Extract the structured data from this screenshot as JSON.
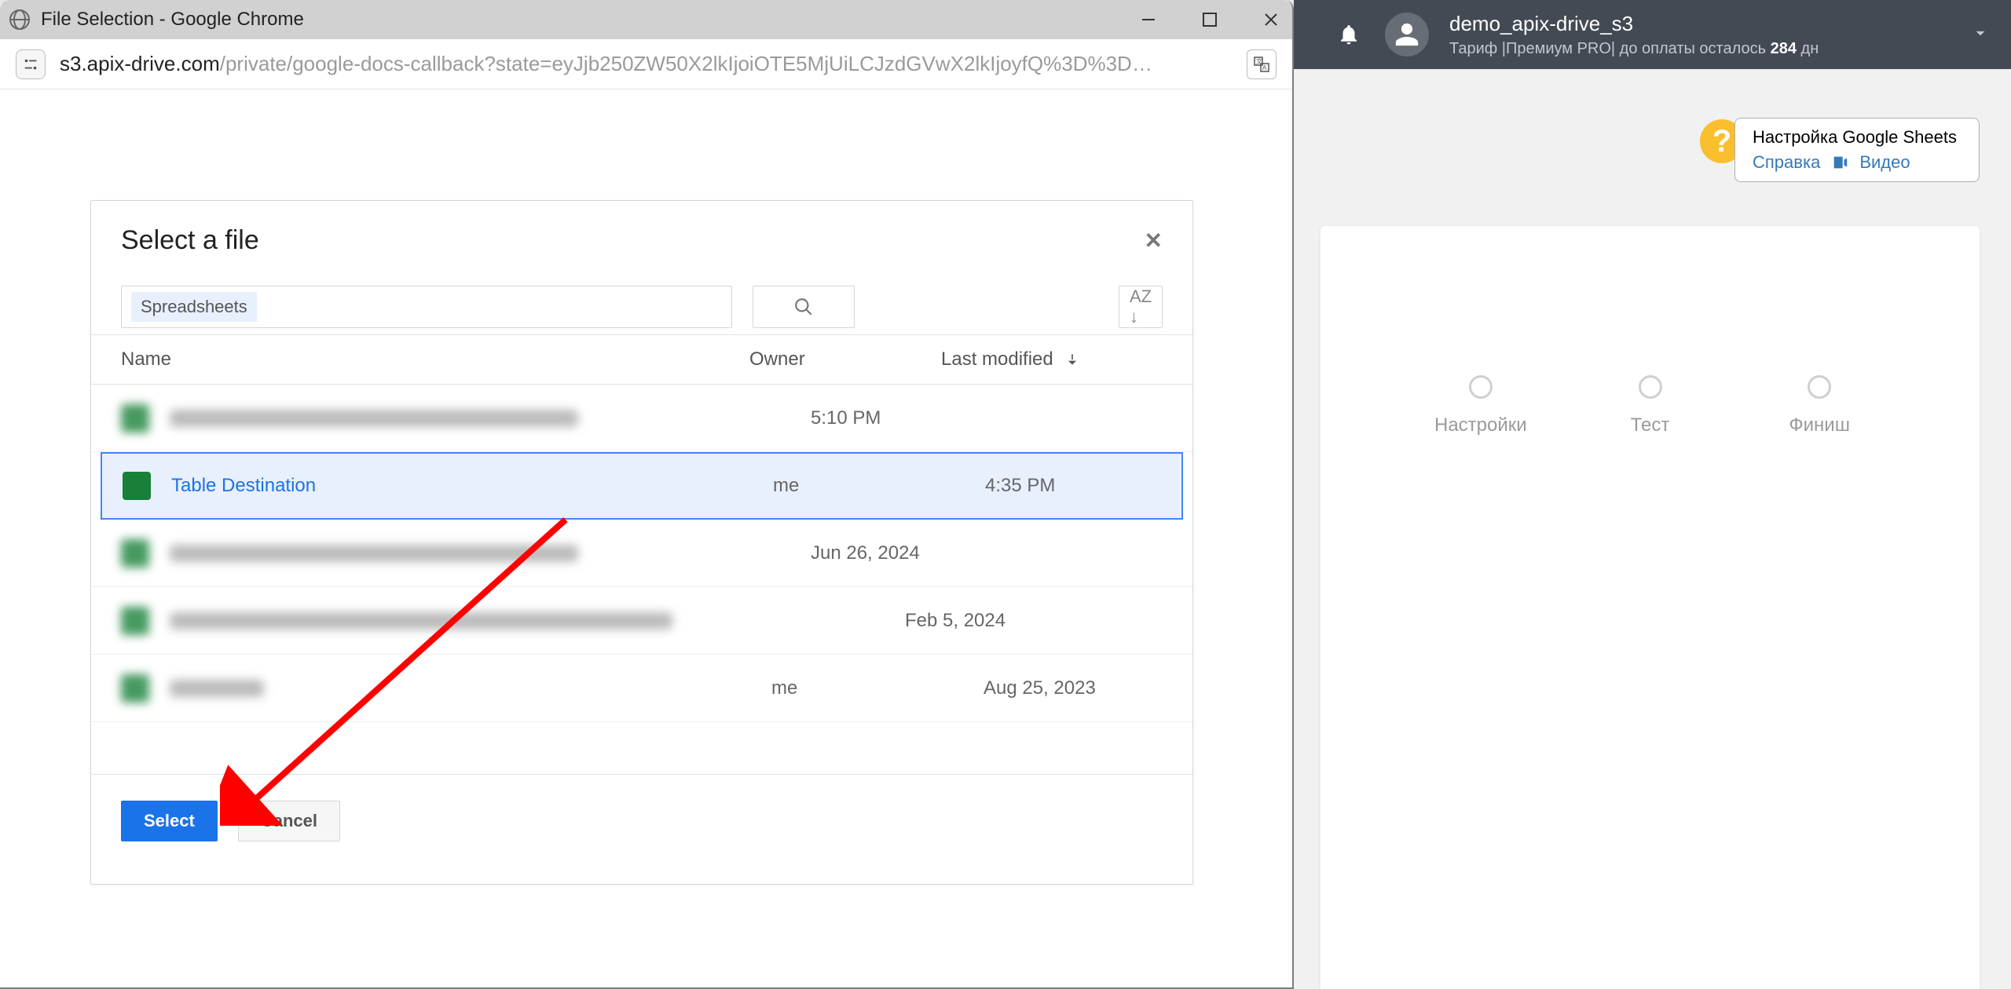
{
  "header": {
    "user_name": "demo_apix-drive_s3",
    "tariff_prefix": "Тариф |Премиум PRO| до оплаты осталось ",
    "tariff_days": "284",
    "tariff_suffix": " дн"
  },
  "help": {
    "title": "Настройка Google Sheets",
    "link1": "Справка",
    "link2": "Видео"
  },
  "steps": {
    "s1": "Настройки",
    "s2": "Тест",
    "s3": "Финиш"
  },
  "window": {
    "title": "File Selection - Google Chrome"
  },
  "addr": {
    "host": "s3.apix-drive.com",
    "path": "/private/google-docs-callback?state=eyJjb250ZW50X2lkIjoiOTE5MjUiLCJzdGVwX2lkIjoyfQ%3D%3D…"
  },
  "picker": {
    "title": "Select a file",
    "chip": "Spreadsheets",
    "col_name": "Name",
    "col_owner": "Owner",
    "col_modified": "Last modified",
    "select": "Select",
    "cancel": "Cancel",
    "rows": [
      {
        "name": "",
        "owner": "",
        "date": "5:10 PM",
        "blur": true
      },
      {
        "name": "Table Destination",
        "owner": "me",
        "date": "4:35 PM",
        "blur": false
      },
      {
        "name": "",
        "owner": "",
        "date": "Jun 26, 2024",
        "blur": true
      },
      {
        "name": "",
        "owner": "",
        "date": "Feb 5, 2024",
        "blur": true
      },
      {
        "name": "",
        "owner": "me",
        "date": "Aug 25, 2023",
        "blur": true
      }
    ]
  }
}
